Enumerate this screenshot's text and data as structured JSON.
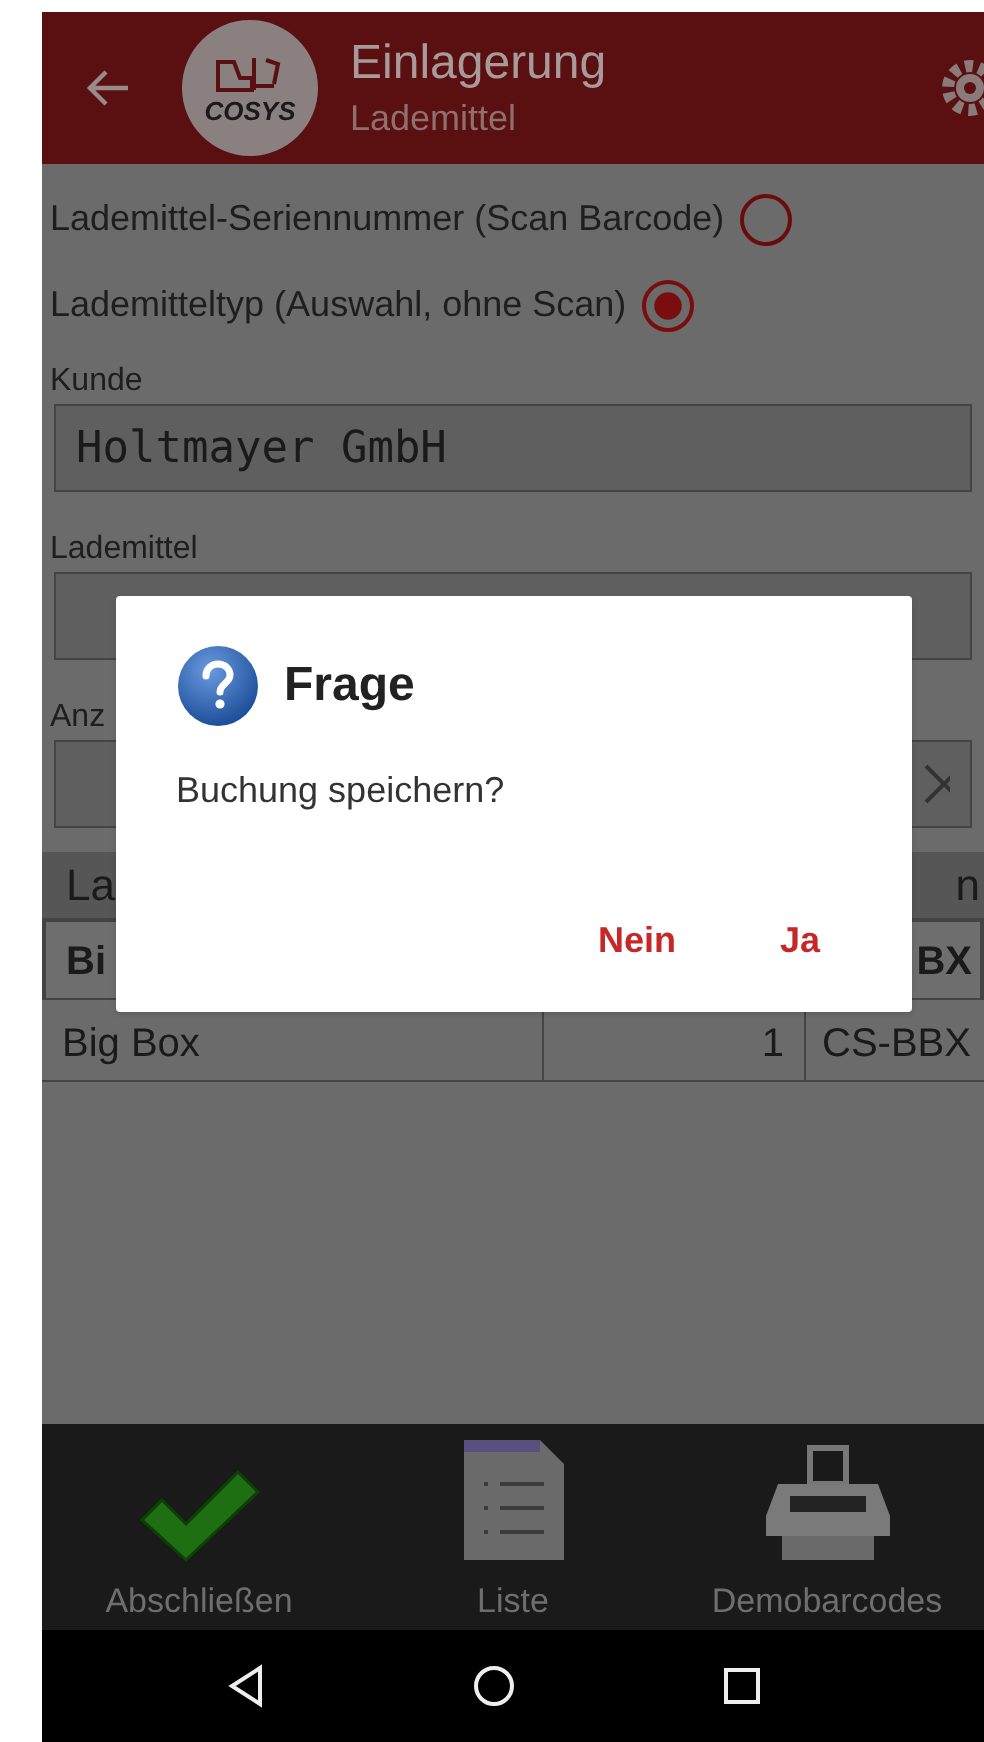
{
  "app_bar": {
    "logo_text": "COSYS",
    "title": "Einlagerung",
    "subtitle": "Lademittel"
  },
  "mode_options": [
    {
      "label": "Lademittel-Seriennummer (Scan Barcode)",
      "selected": false
    },
    {
      "label": "Lademitteltyp (Auswahl, ohne Scan)",
      "selected": true
    }
  ],
  "fields": [
    {
      "label": "Kunde",
      "value": "Holtmayer GmbH",
      "clearable": false
    },
    {
      "label": "Lademittel",
      "clearable": false
    },
    {
      "label": "Anz",
      "clearable": true
    }
  ],
  "table": {
    "columns": {
      "column_1": "La",
      "column_3": "n"
    },
    "rows": [
      {
        "selected": true,
        "column_1": "Bi",
        "column_3": "BX"
      },
      {
        "selected": false,
        "column_1": "Big Box",
        "column_2": "1",
        "column_3": "CS-BBX"
      }
    ]
  },
  "dialog": {
    "title": "Frage",
    "message": "Buchung speichern?",
    "buttons": [
      "Nein",
      "Ja"
    ]
  },
  "bottom_actions": [
    {
      "label": "Abschließen",
      "kind": "check"
    },
    {
      "label": "Liste",
      "kind": "list"
    },
    {
      "label": "Demobarcodes",
      "kind": "printer"
    }
  ]
}
